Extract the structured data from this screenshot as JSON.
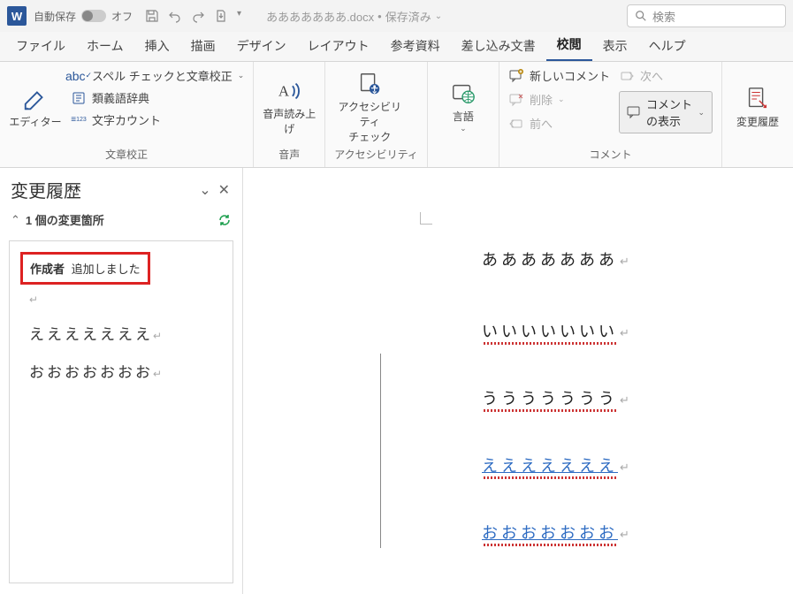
{
  "titlebar": {
    "autosave_label": "自動保存",
    "autosave_state": "オフ",
    "doc_name": "あああああああ.docx",
    "saved_status": "保存済み",
    "search_placeholder": "検索"
  },
  "tabs": {
    "file": "ファイル",
    "home": "ホーム",
    "insert": "挿入",
    "draw": "描画",
    "design": "デザイン",
    "layout": "レイアウト",
    "references": "参考資料",
    "mailings": "差し込み文書",
    "review": "校閲",
    "view": "表示",
    "help": "ヘルプ"
  },
  "ribbon": {
    "editor": {
      "label": "エディター"
    },
    "proof": {
      "spell": "スペル チェックと文章校正",
      "thesaurus": "類義語辞典",
      "wordcount": "文字カウント",
      "group_label": "文章校正"
    },
    "speech": {
      "read_aloud": "音声読み上げ",
      "group_label": "音声"
    },
    "access": {
      "check_label": "アクセシビリティ\nチェック",
      "group_label": "アクセシビリティ"
    },
    "lang": {
      "label": "言語"
    },
    "comments": {
      "new": "新しいコメント",
      "delete": "削除",
      "prev": "前へ",
      "next": "次へ",
      "show": "コメントの表示",
      "group_label": "コメント"
    },
    "track": {
      "label": "変更履歴"
    }
  },
  "pane": {
    "title": "変更履歴",
    "count_label": "1 個の変更箇所",
    "change": {
      "author": "作成者",
      "action": "追加しました"
    },
    "para1": "えええええええ",
    "para2": "おおおおおおお"
  },
  "document": {
    "line1": "あああああああ",
    "line2": "いいいいいいい",
    "line3": "ううううううう",
    "line4": "えええええええ",
    "line5": "おおおおおおお"
  }
}
